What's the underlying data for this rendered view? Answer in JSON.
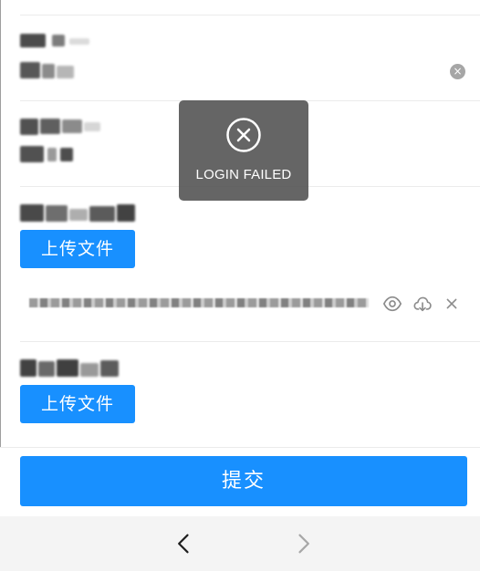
{
  "form": {
    "upload_label": "上传文件",
    "submit_label": "提交",
    "clear_icon": "close-circle-icon",
    "preview_icon": "eye-icon",
    "download_icon": "cloud-download-icon",
    "remove_icon": "close-icon"
  },
  "toast": {
    "message": "LOGIN FAILED",
    "icon": "close-circle-icon"
  },
  "navigation": {
    "back_icon": "chevron-left-icon",
    "forward_icon": "chevron-right-icon"
  }
}
